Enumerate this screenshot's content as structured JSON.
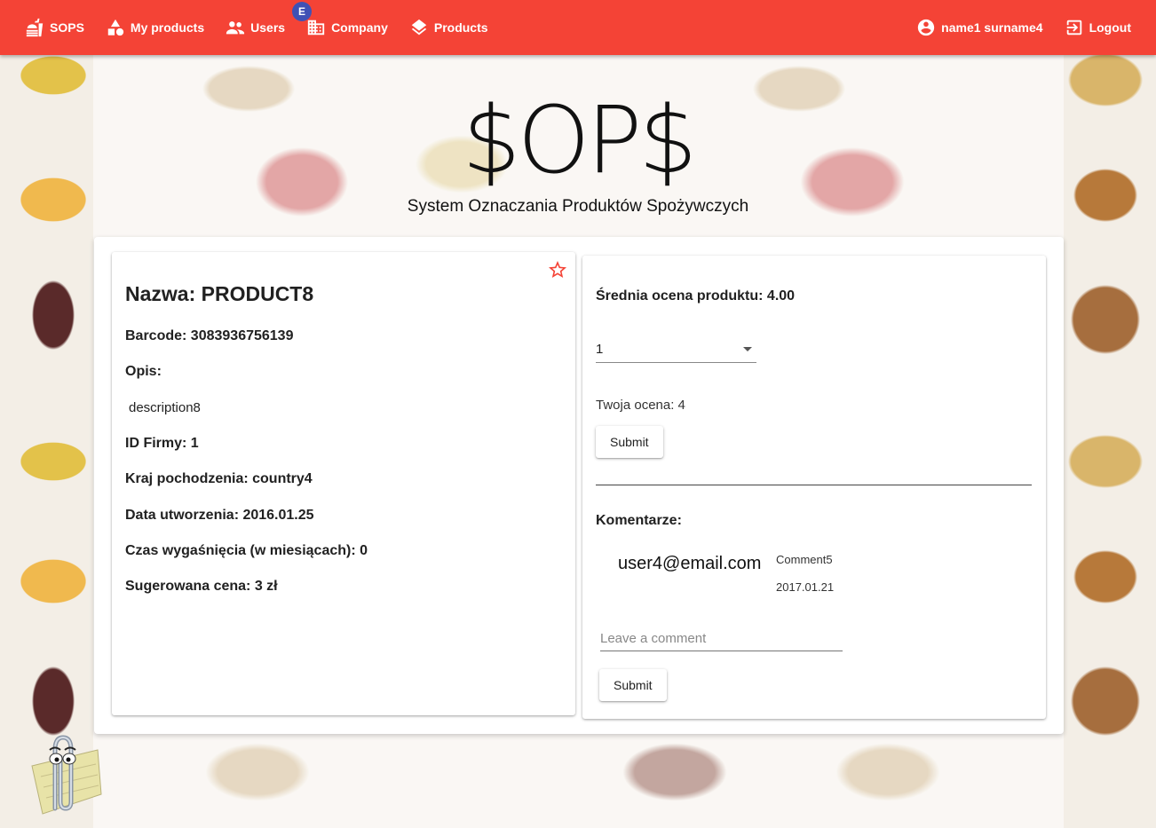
{
  "nav": {
    "brand": "SOPS",
    "my_products": "My products",
    "users": "Users",
    "company": "Company",
    "company_badge": "E",
    "products": "Products",
    "user": "name1 surname4",
    "logout": "Logout"
  },
  "hero": {
    "title": "$OP$",
    "subtitle": "System Oznaczania Produktów Spożywczych"
  },
  "product": {
    "name": "Nazwa: PRODUCT8",
    "barcode": "Barcode: 3083936756139",
    "desc_label": "Opis:",
    "description": "description8",
    "company_id": "ID Firmy: 1",
    "country": "Kraj pochodzenia: country4",
    "created": "Data utworzenia: 2016.01.25",
    "expiry": "Czas wygaśnięcia (w miesiącach): 0",
    "price": "Sugerowana cena: 3 zł"
  },
  "rating": {
    "average": "Średnia ocena produktu: 4.00",
    "selected": "1",
    "your_rating": "Twoja ocena: 4",
    "submit": "Submit"
  },
  "comments": {
    "title": "Komentarze:",
    "items": [
      {
        "user": "user4@email.com",
        "text": "Comment5",
        "date": "2017.01.21"
      }
    ],
    "placeholder": "Leave a comment",
    "submit": "Submit"
  },
  "colors": {
    "primary": "#f44336",
    "badge": "#3f51b5"
  }
}
